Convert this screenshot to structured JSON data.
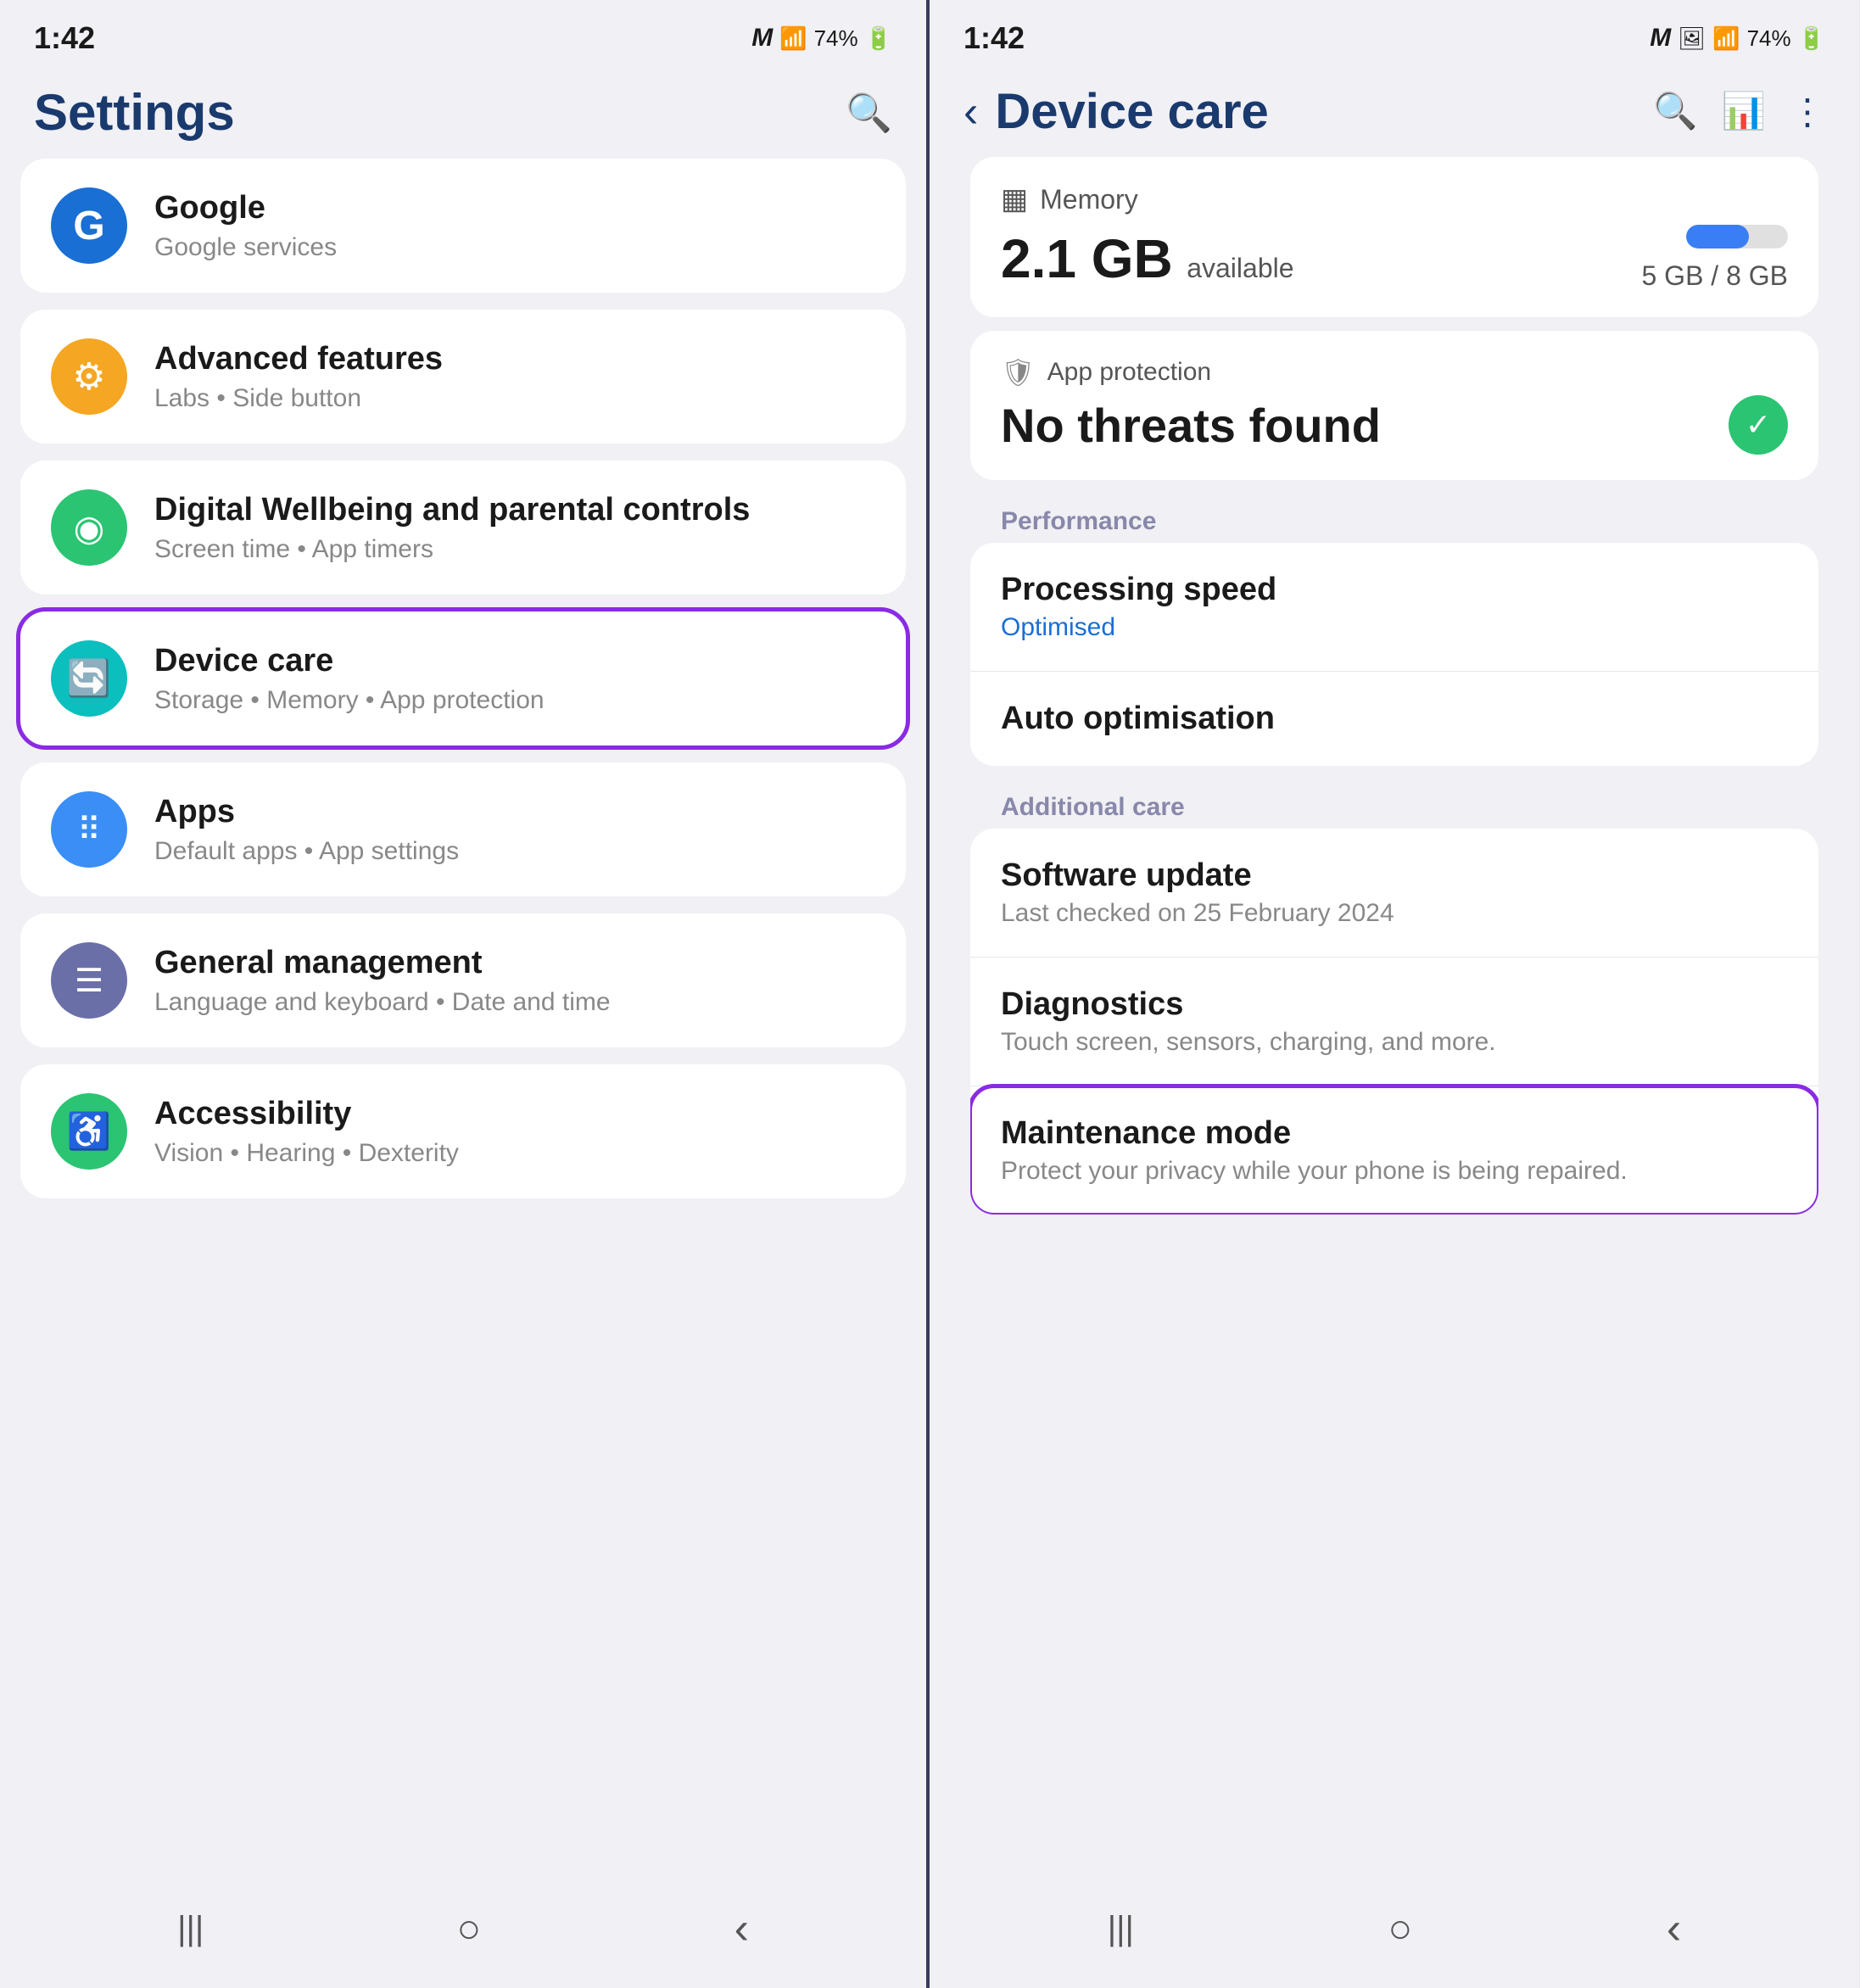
{
  "left": {
    "statusBar": {
      "time": "1:42",
      "emailIcon": "M",
      "batteryPercent": "74%"
    },
    "header": {
      "title": "Settings",
      "searchLabel": "Search"
    },
    "items": [
      {
        "id": "google",
        "iconColor": "icon-blue",
        "iconChar": "G",
        "title": "Google",
        "subtitle": "Google services"
      },
      {
        "id": "advanced-features",
        "iconColor": "icon-orange",
        "iconChar": "⚙",
        "title": "Advanced features",
        "subtitle": "Labs • Side button"
      },
      {
        "id": "digital-wellbeing",
        "iconColor": "icon-green",
        "iconChar": "◎",
        "title": "Digital Wellbeing and parental controls",
        "subtitle": "Screen time • App timers"
      },
      {
        "id": "device-care",
        "iconColor": "icon-teal",
        "iconChar": "⟳",
        "title": "Device care",
        "subtitle": "Storage • Memory • App protection",
        "highlighted": true
      },
      {
        "id": "apps",
        "iconColor": "icon-appblue",
        "iconChar": "⠿",
        "title": "Apps",
        "subtitle": "Default apps • App settings"
      },
      {
        "id": "general-management",
        "iconColor": "icon-purple",
        "iconChar": "☰",
        "title": "General management",
        "subtitle": "Language and keyboard • Date and time"
      },
      {
        "id": "accessibility",
        "iconColor": "icon-green2",
        "iconChar": "♿",
        "title": "Accessibility",
        "subtitle": "Vision • Hearing • Dexterity"
      }
    ],
    "navBar": {
      "recentIcon": "|||",
      "homeIcon": "○",
      "backIcon": "‹"
    }
  },
  "right": {
    "statusBar": {
      "time": "1:42",
      "batteryPercent": "74%"
    },
    "header": {
      "backLabel": "‹",
      "title": "Device care"
    },
    "memory": {
      "label": "Memory",
      "available": "2.1 GB",
      "availableLabel": "available",
      "total": "5 GB / 8 GB",
      "fillPercent": 62
    },
    "appProtection": {
      "label": "App protection",
      "status": "No threats found"
    },
    "performanceSection": {
      "label": "Performance",
      "items": [
        {
          "id": "processing-speed",
          "title": "Processing speed",
          "subtitle": "Optimised",
          "subtitleBlue": true
        },
        {
          "id": "auto-optimisation",
          "title": "Auto optimisation",
          "subtitle": ""
        }
      ]
    },
    "additionalCareSection": {
      "label": "Additional care",
      "items": [
        {
          "id": "software-update",
          "title": "Software update",
          "subtitle": "Last checked on 25 February 2024"
        },
        {
          "id": "diagnostics",
          "title": "Diagnostics",
          "subtitle": "Touch screen, sensors, charging, and more."
        },
        {
          "id": "maintenance-mode",
          "title": "Maintenance mode",
          "subtitle": "Protect your privacy while your phone is being repaired.",
          "highlighted": true
        }
      ]
    },
    "navBar": {
      "recentIcon": "|||",
      "homeIcon": "○",
      "backIcon": "‹"
    }
  }
}
